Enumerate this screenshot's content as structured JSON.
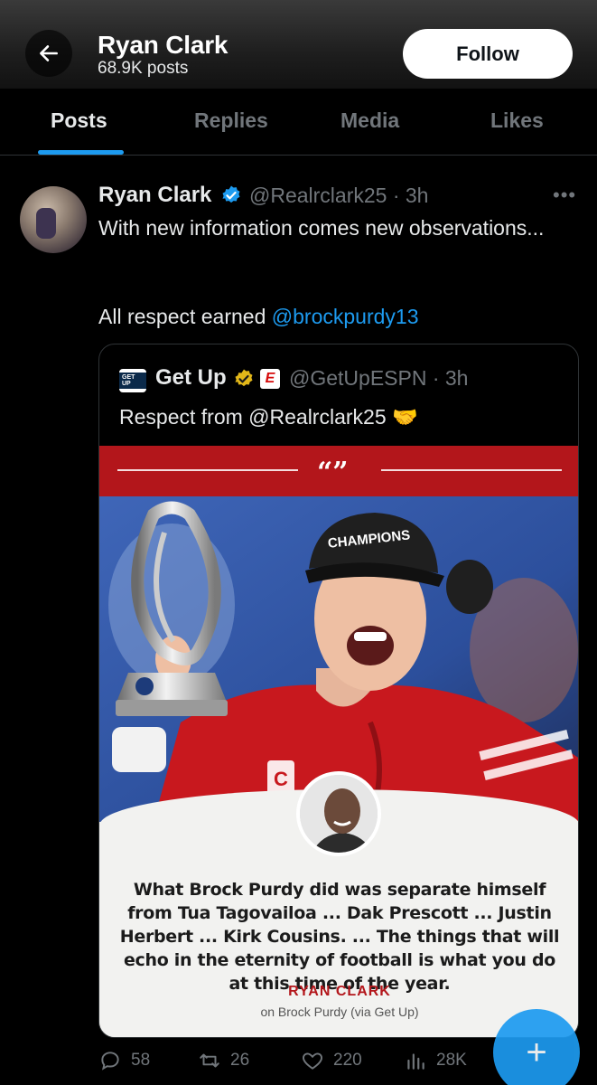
{
  "header": {
    "name": "Ryan Clark",
    "posts_count": "68.9K posts",
    "follow_label": "Follow"
  },
  "tabs": [
    {
      "label": "Posts",
      "active": true
    },
    {
      "label": "Replies",
      "active": false
    },
    {
      "label": "Media",
      "active": false
    },
    {
      "label": "Likes",
      "active": false
    }
  ],
  "tweet": {
    "author_name": "Ryan Clark",
    "author_handle": "@Realrclark25 · 3h",
    "text_line1": "With new information comes new observations...",
    "text_line2_prefix": "All respect earned ",
    "text_line2_mention": "@brockpurdy13",
    "quoted": {
      "logo_text": "GET UP",
      "name": "Get Up",
      "handle": "@GetUpESPN · 3h",
      "text": "Respect from @Realrclark25 🤝",
      "card": {
        "quote_mark": "“”",
        "quote": "What Brock Purdy did was separate himself from Tua Tagovailoa ... Dak Prescott ... Justin Herbert ... Kirk Cousins. ... The things that will echo in the eternity of football is what you do at this time of the year.",
        "author": "RYAN CLARK",
        "subtitle": "on Brock Purdy (via Get Up)",
        "cap_text": "CHAMPIONS"
      }
    },
    "actions": {
      "replies": "58",
      "reposts": "26",
      "likes": "220",
      "views": "28K"
    }
  },
  "colors": {
    "accent": "#1d9bf0",
    "banner_red": "#b3161b",
    "background": "#000000"
  }
}
